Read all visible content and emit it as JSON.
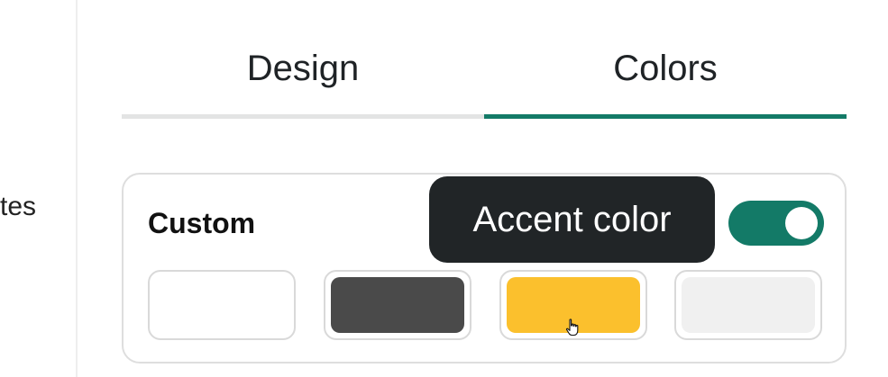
{
  "sidebar": {
    "partial_label": "tes"
  },
  "tabs": [
    {
      "label": "Design",
      "active": false
    },
    {
      "label": "Colors",
      "active": true
    }
  ],
  "custom_card": {
    "title": "Custom",
    "toggle_on": true,
    "swatches": [
      {
        "name": "white",
        "color": "#ffffff"
      },
      {
        "name": "dark-gray",
        "color": "#4a4a4a"
      },
      {
        "name": "yellow",
        "color": "#fbc02d"
      },
      {
        "name": "light-gray",
        "color": "#f0f0f0"
      }
    ]
  },
  "tooltip": {
    "text": "Accent color"
  },
  "colors": {
    "accent": "#137a67",
    "tooltip_bg": "#212527",
    "inactive_underline": "#e3e4e4"
  },
  "cursor": {
    "icon": "hand-pointer-icon"
  }
}
